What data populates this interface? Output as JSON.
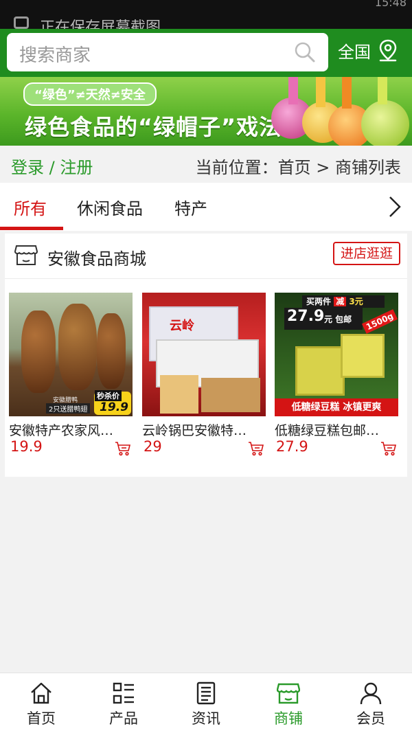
{
  "status_bar": {
    "notification_text": "正在保存屏幕截图",
    "time": "15:48"
  },
  "header": {
    "search_placeholder": "搜索商家",
    "region_label": "全国"
  },
  "banner": {
    "tag": "“绿色”≠天然≠安全",
    "headline": "绿色食品的“绿帽子”戏法"
  },
  "breadcrumb": {
    "auth": "登录 / 注册",
    "location": "当前位置：首页 > 商铺列表"
  },
  "tabs": [
    {
      "label": "所有",
      "active": true
    },
    {
      "label": "休闲食品",
      "active": false
    },
    {
      "label": "特产",
      "active": false
    }
  ],
  "store": {
    "name": "安徽食品商城",
    "visit_label": "进店逛逛",
    "products": [
      {
        "name": "安徽特产农家风…",
        "price": "19.9",
        "image_text": [
          "秒杀价",
          "19.9",
          "安徽腊鸭",
          "2只送腊鸭翅"
        ]
      },
      {
        "name": "云岭锅巴安徽特…",
        "price": "29",
        "image_text": [
          "云岭"
        ]
      },
      {
        "name": "低糖绿豆糕包邮…",
        "price": "27.9",
        "image_text": [
          "买两件",
          "减",
          "3元",
          "27.9",
          "元 包邮",
          "1500g",
          "低糖绿豆糕 冰镇更爽"
        ]
      }
    ]
  },
  "bottom_nav": [
    {
      "label": "首页",
      "icon": "home-icon",
      "active": false
    },
    {
      "label": "产品",
      "icon": "grid-list-icon",
      "active": false
    },
    {
      "label": "资讯",
      "icon": "news-icon",
      "active": false
    },
    {
      "label": "商铺",
      "icon": "store-icon",
      "active": true
    },
    {
      "label": "会员",
      "icon": "user-icon",
      "active": false
    }
  ],
  "colors": {
    "brand_green": "#1f8c1f",
    "accent_red": "#d41414",
    "link_green": "#2a9a2a"
  }
}
